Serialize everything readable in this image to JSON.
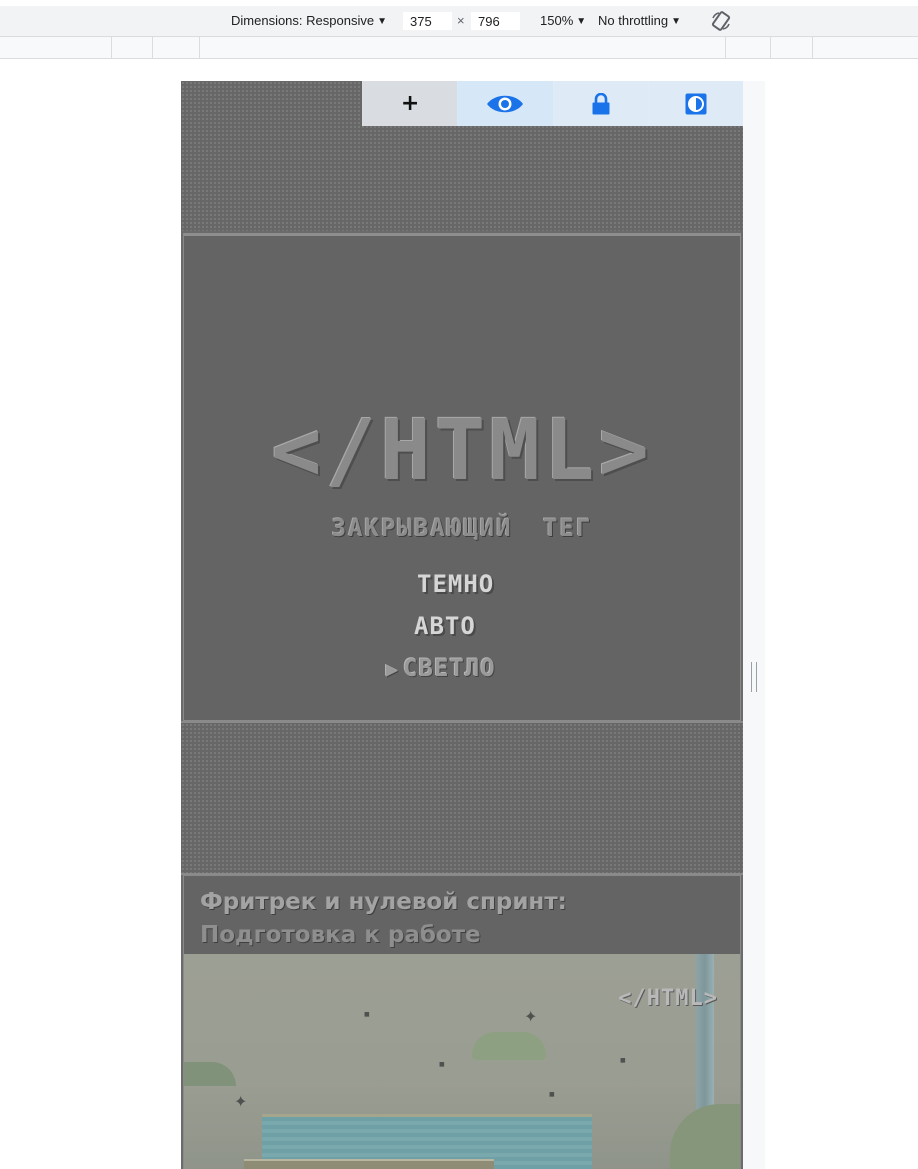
{
  "devtools": {
    "dimensions_label": "Dimensions: Responsive",
    "width_value": "375",
    "times_sign": "×",
    "height_value": "796",
    "zoom": "150%",
    "throttling": "No throttling"
  },
  "controls": {
    "plus_label": "+"
  },
  "hero": {
    "logo": "</HTML>",
    "subtitle": "ЗАКРЫВАЮЩИЙ ТЕГ",
    "pointer": "▶",
    "menu": [
      {
        "label": "ТЕМНО"
      },
      {
        "label": "АВТО"
      },
      {
        "label": "СВЕТЛО"
      }
    ]
  },
  "card": {
    "title_line1": "Фритрек и нулевой спринт:",
    "title_line2": "Подготовка к работе",
    "image_logo": "</HTML>"
  },
  "colors": {
    "accent": "#1a73e8",
    "page_gray": "#646464"
  }
}
